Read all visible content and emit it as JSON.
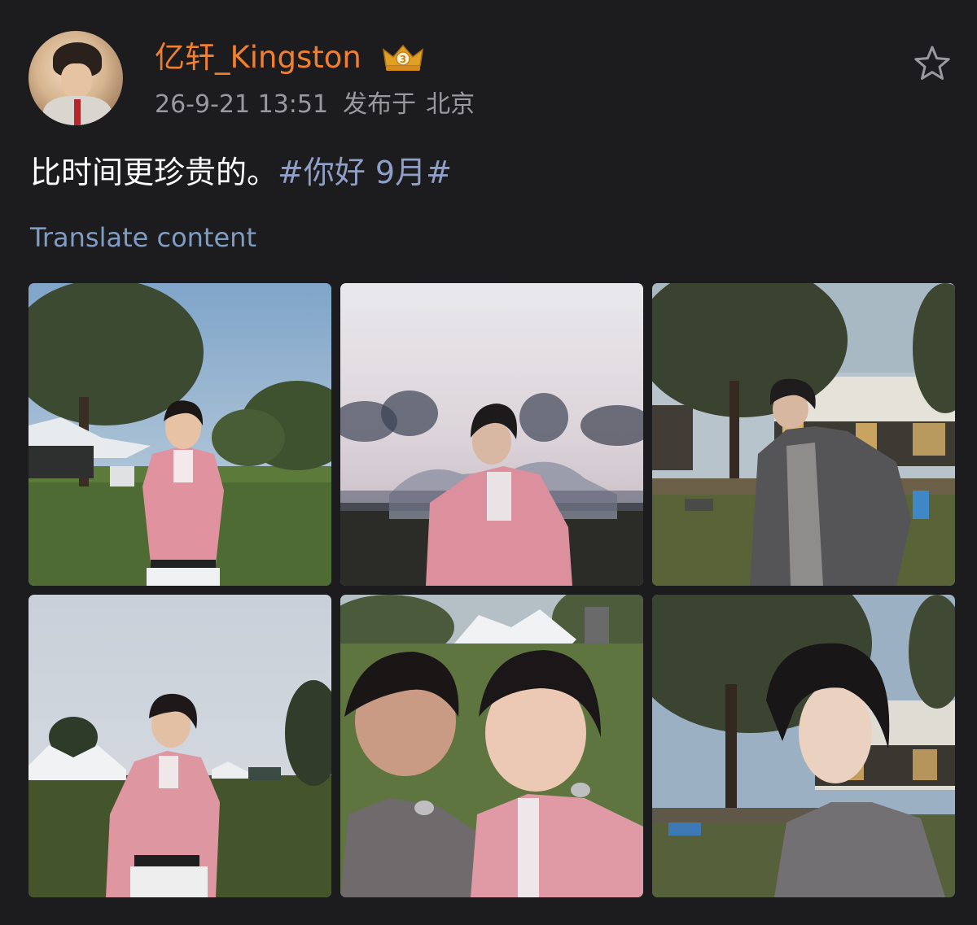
{
  "post": {
    "username": "亿轩_Kingston",
    "date": "26-9-21 13:51",
    "published_label": "发布于",
    "location": "北京",
    "text": "比时间更珍贵的。",
    "hashtag": "#你好 9月#",
    "translate_label": "Translate content",
    "badge_icon": "crown-badge-icon",
    "favorite_icon": "star-icon"
  },
  "colors": {
    "background": "#1c1c1e",
    "username": "#f0802f",
    "meta": "#9a9a9e",
    "hashtag": "#8ea0c8",
    "translate": "#7f9dc4"
  },
  "photos": [
    {
      "id": "photo-1"
    },
    {
      "id": "photo-2"
    },
    {
      "id": "photo-3"
    },
    {
      "id": "photo-4"
    },
    {
      "id": "photo-5"
    },
    {
      "id": "photo-6"
    }
  ]
}
